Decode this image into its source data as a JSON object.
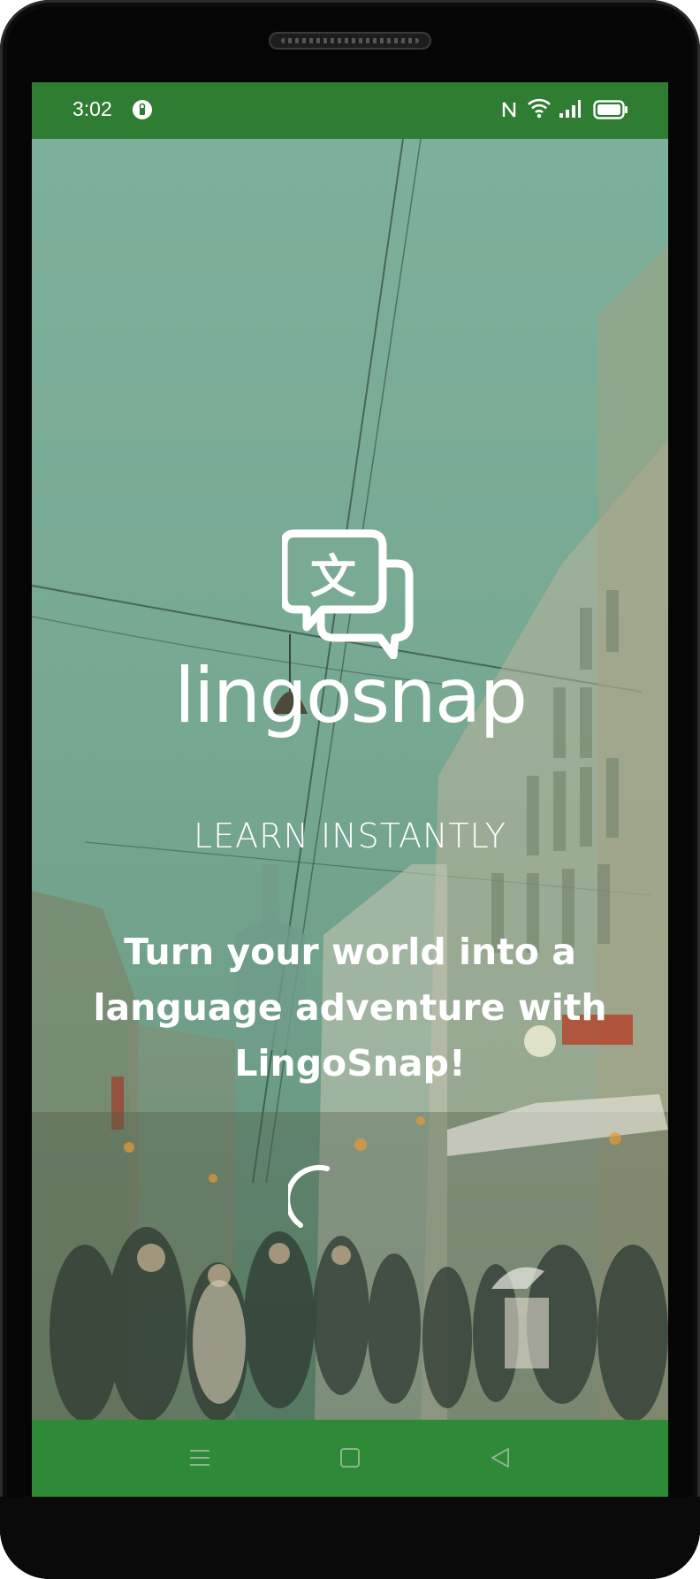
{
  "status_bar": {
    "time": "3:02",
    "icons": [
      "privacy-dot-icon",
      "nfc-icon",
      "wifi-icon",
      "signal-icon",
      "battery-icon"
    ]
  },
  "splash": {
    "logo_icon": "translate-chat-bubbles-icon",
    "brand_name": "lingosnap",
    "tagline": "LEARN INSTANTLY",
    "headline": "Turn your world into a language adventure with LingoSnap!",
    "loading_icon": "loading-spinner-icon"
  },
  "nav_bar": {
    "icons": [
      "menu-icon",
      "home-square-icon",
      "back-triangle-icon"
    ]
  },
  "colors": {
    "primary_green": "#2e7d32",
    "nav_green": "#2e8a36",
    "overlay_tint": "#76a892",
    "text": "#ffffff"
  }
}
